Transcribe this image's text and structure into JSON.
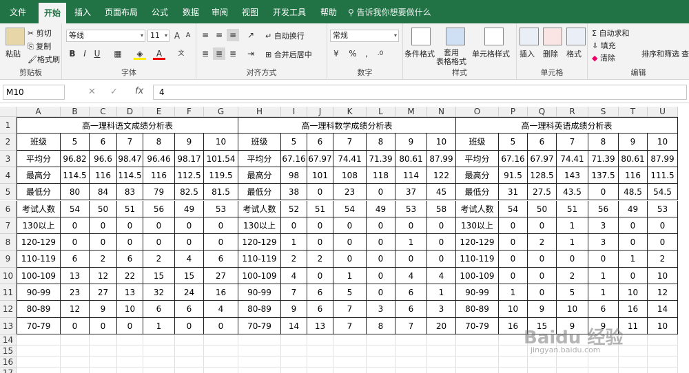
{
  "menu": {
    "tabs": [
      "文件",
      "开始",
      "插入",
      "页面布局",
      "公式",
      "数据",
      "审阅",
      "视图",
      "开发工具",
      "帮助"
    ],
    "active": 1,
    "tellme": "告诉我你想要做什么"
  },
  "ribbon": {
    "clipboard": {
      "paste": "粘贴",
      "cut": "剪切",
      "copy": "复制",
      "format_painter": "格式刷",
      "label": "剪贴板"
    },
    "font": {
      "name": "等线",
      "size": "11",
      "label": "字体"
    },
    "align": {
      "wrap": "自动换行",
      "merge": "合并后居中",
      "label": "对齐方式"
    },
    "number": {
      "format": "常规",
      "label": "数字"
    },
    "styles": {
      "cond": "条件格式",
      "table": "套用\n表格格式",
      "cell": "单元格样式",
      "label": "样式"
    },
    "cells": {
      "insert": "插入",
      "delete": "删除",
      "format": "格式",
      "label": "单元格"
    },
    "edit": {
      "autosum": "自动求和",
      "fill": "填充",
      "clear": "清除",
      "sort": "排序和筛选",
      "find": "查",
      "label": "编辑"
    }
  },
  "formula_bar": {
    "name_box": "M10",
    "value": "4"
  },
  "columns": [
    "A",
    "B",
    "C",
    "D",
    "E",
    "F",
    "G",
    "H",
    "I",
    "J",
    "K",
    "L",
    "M",
    "N",
    "O",
    "P",
    "Q",
    "R",
    "S",
    "T",
    "U"
  ],
  "rows": [
    "1",
    "2",
    "3",
    "4",
    "5",
    "6",
    "7",
    "8",
    "9",
    "10",
    "11",
    "12",
    "13",
    "14",
    "15",
    "16",
    "17"
  ],
  "titles": [
    "高一理科语文成绩分析表",
    "高一理科数学成绩分析表",
    "高一理科英语成绩分析表"
  ],
  "table": [
    [
      "班级",
      "5",
      "6",
      "7",
      "8",
      "9",
      "10",
      "班级",
      "5",
      "6",
      "7",
      "8",
      "9",
      "10",
      "班级",
      "5",
      "6",
      "7",
      "8",
      "9",
      "10"
    ],
    [
      "平均分",
      "96.82",
      "96.6",
      "98.47",
      "96.46",
      "98.17",
      "101.54",
      "平均分",
      "67.16",
      "67.97",
      "74.41",
      "71.39",
      "80.61",
      "87.99",
      "平均分",
      "67.16",
      "67.97",
      "74.41",
      "71.39",
      "80.61",
      "87.99"
    ],
    [
      "最高分",
      "114.5",
      "116",
      "114.5",
      "116",
      "112.5",
      "119.5",
      "最高分",
      "98",
      "101",
      "108",
      "118",
      "114",
      "122",
      "最高分",
      "91.5",
      "128.5",
      "143",
      "137.5",
      "116",
      "111.5"
    ],
    [
      "最低分",
      "80",
      "84",
      "83",
      "79",
      "82.5",
      "81.5",
      "最低分",
      "38",
      "0",
      "23",
      "0",
      "37",
      "45",
      "最低分",
      "31",
      "27.5",
      "43.5",
      "0",
      "48.5",
      "54.5"
    ],
    [
      "考试人数",
      "54",
      "50",
      "51",
      "56",
      "49",
      "53",
      "考试人数",
      "52",
      "51",
      "54",
      "49",
      "53",
      "58",
      "考试人数",
      "54",
      "50",
      "51",
      "56",
      "49",
      "53"
    ],
    [
      "130以上",
      "0",
      "0",
      "0",
      "0",
      "0",
      "0",
      "130以上",
      "0",
      "0",
      "0",
      "0",
      "0",
      "0",
      "130以上",
      "0",
      "0",
      "1",
      "3",
      "0",
      "0"
    ],
    [
      "120-129",
      "0",
      "0",
      "0",
      "0",
      "0",
      "0",
      "120-129",
      "1",
      "0",
      "0",
      "0",
      "1",
      "0",
      "120-129",
      "0",
      "2",
      "1",
      "3",
      "0",
      "0"
    ],
    [
      "110-119",
      "6",
      "2",
      "6",
      "2",
      "4",
      "6",
      "110-119",
      "2",
      "2",
      "0",
      "0",
      "0",
      "0",
      "110-119",
      "0",
      "0",
      "0",
      "0",
      "1",
      "2"
    ],
    [
      "100-109",
      "13",
      "12",
      "22",
      "15",
      "15",
      "27",
      "100-109",
      "4",
      "0",
      "1",
      "0",
      "4",
      "4",
      "100-109",
      "0",
      "0",
      "2",
      "1",
      "0",
      "10"
    ],
    [
      "90-99",
      "23",
      "27",
      "13",
      "32",
      "24",
      "16",
      "90-99",
      "7",
      "6",
      "5",
      "0",
      "6",
      "1",
      "90-99",
      "1",
      "0",
      "5",
      "1",
      "10",
      "12"
    ],
    [
      "80-89",
      "12",
      "9",
      "10",
      "6",
      "6",
      "4",
      "80-89",
      "9",
      "6",
      "7",
      "3",
      "6",
      "3",
      "80-89",
      "10",
      "9",
      "10",
      "6",
      "16",
      "14"
    ],
    [
      "70-79",
      "0",
      "0",
      "0",
      "1",
      "0",
      "0",
      "70-79",
      "14",
      "13",
      "7",
      "8",
      "7",
      "20",
      "70-79",
      "16",
      "15",
      "9",
      "9",
      "11",
      "10"
    ]
  ],
  "watermark": {
    "big": "Baidu 经验",
    "small": "jingyan.baidu.com"
  }
}
